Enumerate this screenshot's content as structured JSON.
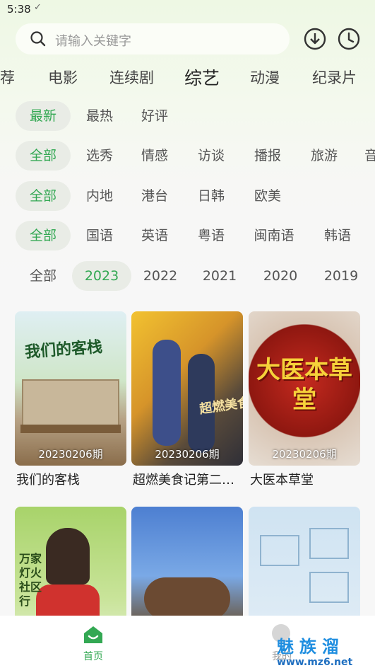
{
  "status_bar": {
    "time": "5:38",
    "check": "✓"
  },
  "search": {
    "placeholder": "请输入关键字"
  },
  "nav_tabs": [
    "荐",
    "电影",
    "连续剧",
    "综艺",
    "动漫",
    "纪录片"
  ],
  "filters": {
    "sort": [
      "最新",
      "最热",
      "好评"
    ],
    "genre": [
      "全部",
      "选秀",
      "情感",
      "访谈",
      "播报",
      "旅游",
      "音"
    ],
    "region": [
      "全部",
      "内地",
      "港台",
      "日韩",
      "欧美"
    ],
    "language": [
      "全部",
      "国语",
      "英语",
      "粤语",
      "闽南语",
      "韩语"
    ],
    "year": [
      "全部",
      "2023",
      "2022",
      "2021",
      "2020",
      "2019"
    ]
  },
  "cards": [
    {
      "title": "我们的客栈",
      "episode": "20230206期",
      "art": "我们的客栈"
    },
    {
      "title": "超燃美食记第二…",
      "episode": "20230206期",
      "art": "超燃美食记"
    },
    {
      "title": "大医本草堂",
      "episode": "20230206期",
      "art": "大医本草堂"
    },
    {
      "title": "",
      "episode": "",
      "art": "万家灯火 社区行"
    },
    {
      "title": "",
      "episode": "",
      "art": ""
    },
    {
      "title": "",
      "episode": "",
      "art": ""
    }
  ],
  "bottom_nav": {
    "home": "首页",
    "me": "我的"
  },
  "watermark": {
    "text": "魅族溜",
    "url": "www.mz6.net"
  },
  "colors": {
    "accent": "#33a853",
    "chip_bg": "#e9ece6",
    "watermark": "#1f8ee0"
  }
}
